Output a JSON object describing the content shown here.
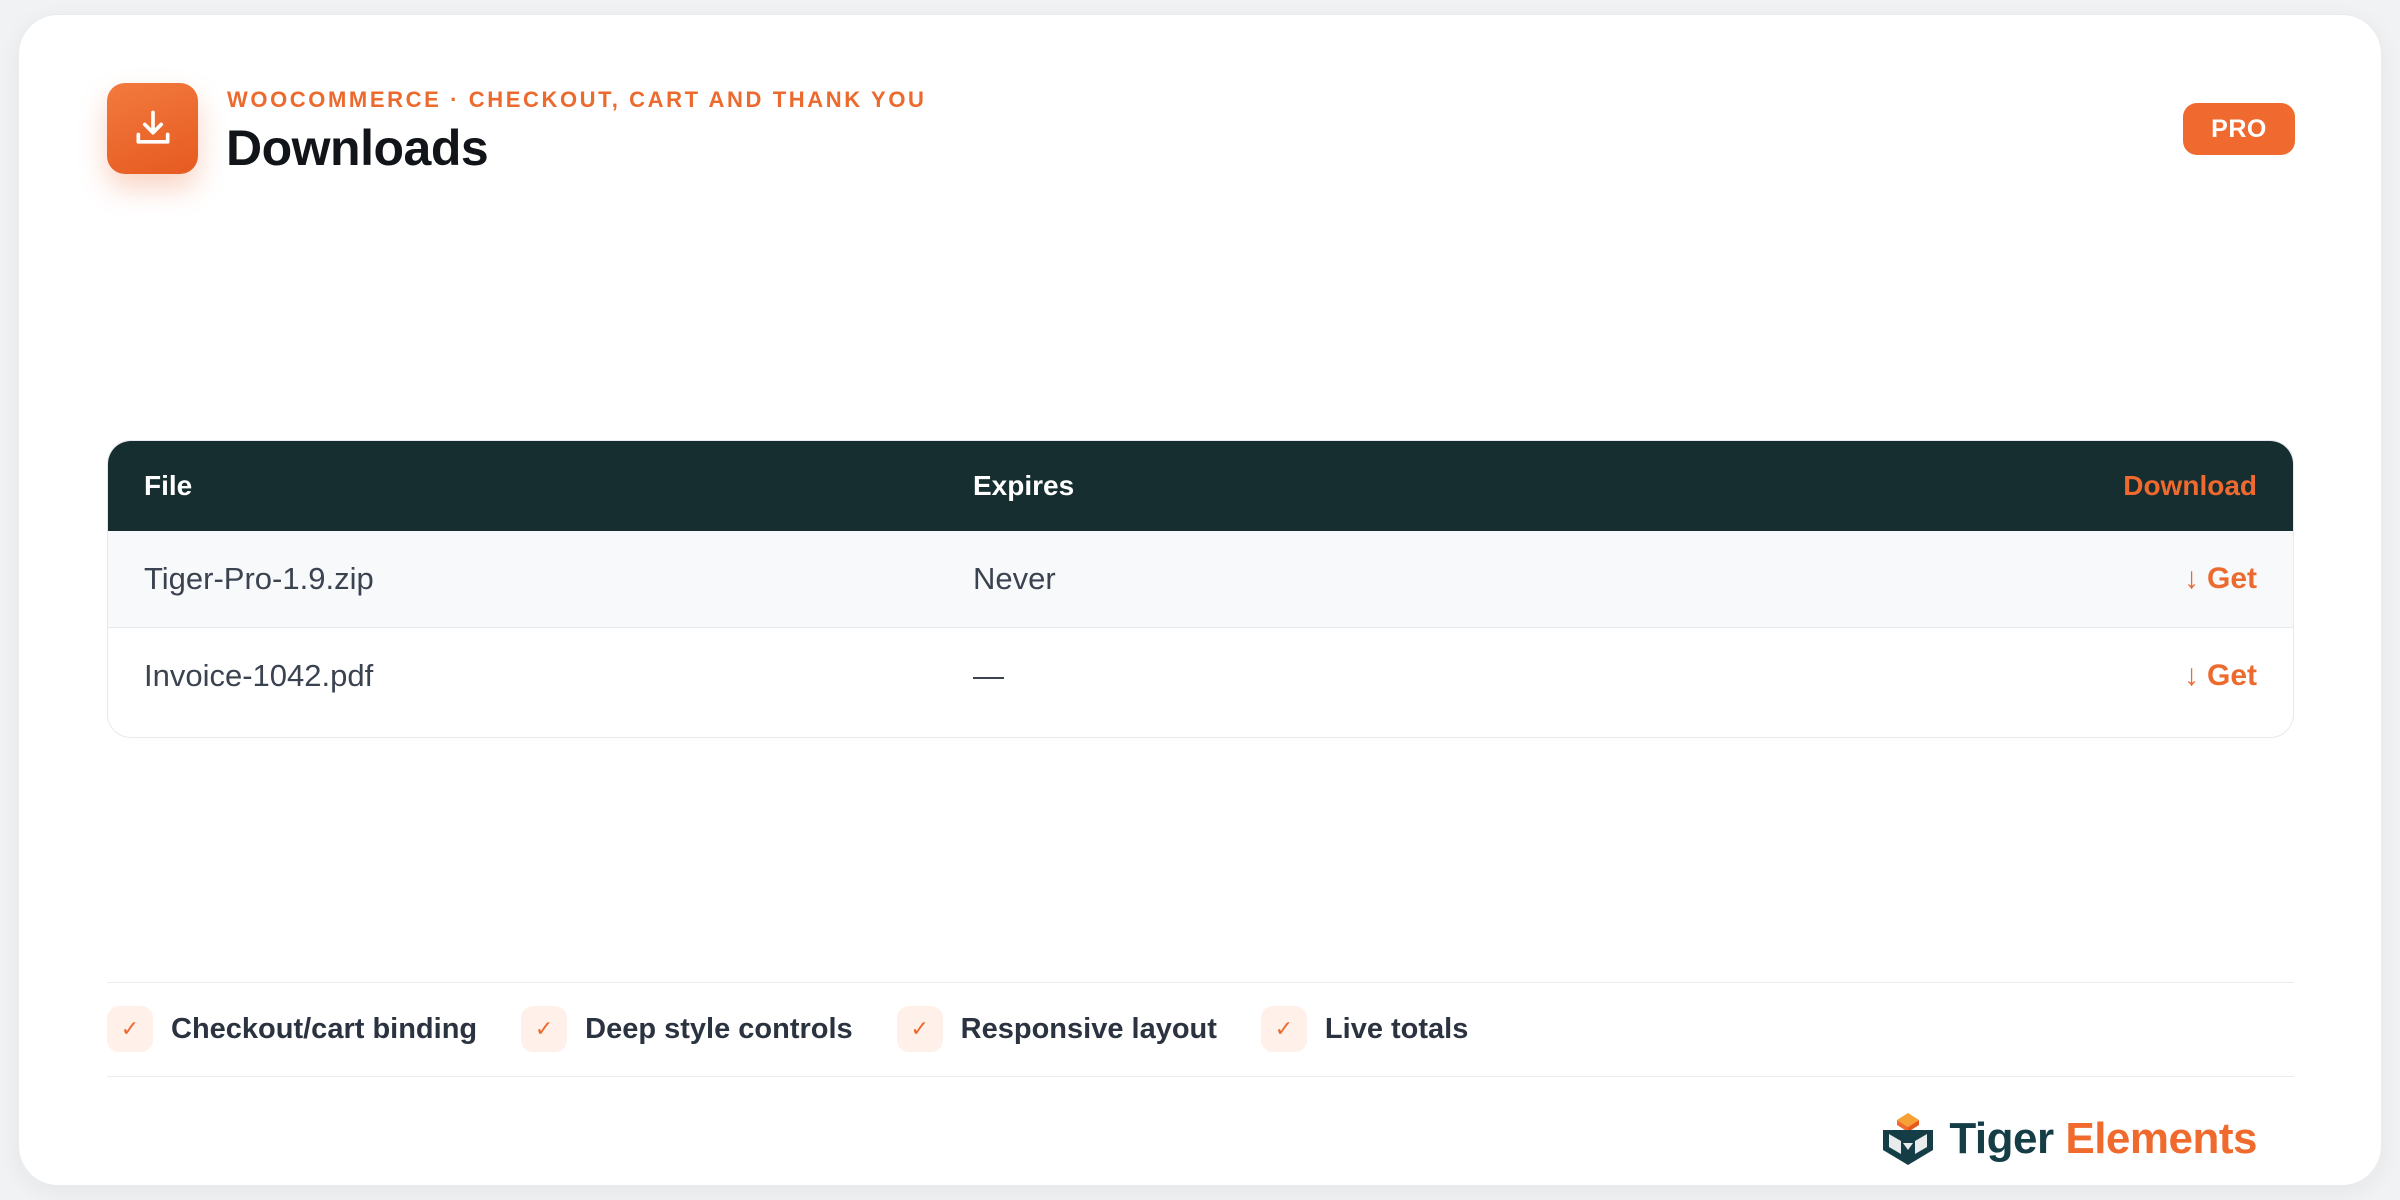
{
  "header": {
    "eyebrow": "WOOCOMMERCE · CHECKOUT, CART AND THANK YOU",
    "title": "Downloads",
    "icon": "download-icon",
    "badge": "PRO"
  },
  "table": {
    "columns": {
      "file": "File",
      "expires": "Expires",
      "download": "Download"
    },
    "rows": [
      {
        "file": "Tiger-Pro-1.9.zip",
        "expires": "Never",
        "action": "Get",
        "arrow": "↓"
      },
      {
        "file": "Invoice-1042.pdf",
        "expires": "—",
        "action": "Get",
        "arrow": "↓"
      }
    ]
  },
  "features": [
    {
      "label": "Checkout/cart binding",
      "mark": "✓"
    },
    {
      "label": "Deep style controls",
      "mark": "✓"
    },
    {
      "label": "Responsive layout",
      "mark": "✓"
    },
    {
      "label": "Live totals",
      "mark": "✓"
    }
  ],
  "brand": {
    "name_part1": "Tiger",
    "name_part2": "Elements",
    "logo": "tiger-elements-logo"
  },
  "colors": {
    "accent": "#f0692e",
    "header_bg": "#172e30",
    "brand_dark": "#143d45"
  }
}
